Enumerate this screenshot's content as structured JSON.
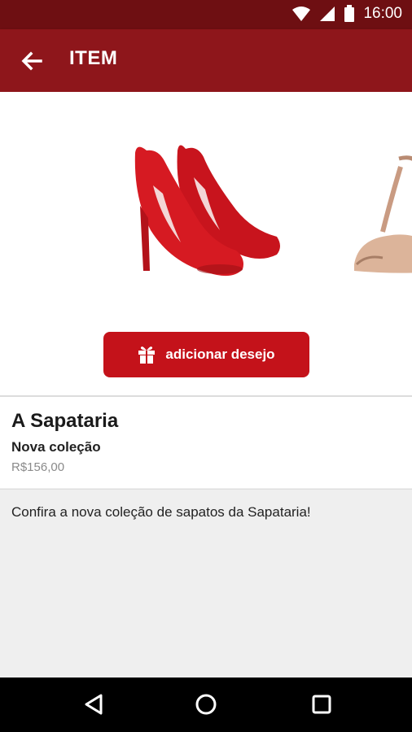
{
  "status_bar": {
    "time": "16:00",
    "icons": [
      "wifi-icon",
      "signal-icon",
      "battery-icon"
    ]
  },
  "app_bar": {
    "title": "ITEM",
    "back_icon": "arrow-left-icon"
  },
  "hero": {
    "main_image": "red-high-heel-shoes",
    "next_image": "nude-sandal-shoe",
    "wish_button": {
      "icon": "gift-icon",
      "label": "adicionar desejo"
    }
  },
  "product": {
    "store": "A Sapataria",
    "collection": "Nova coleção",
    "price": "R$156,00"
  },
  "description": "Confira a nova coleção de sapatos da Sapataria!",
  "nav": {
    "back": "nav-back-icon",
    "home": "nav-home-icon",
    "recents": "nav-recents-icon"
  },
  "colors": {
    "status": "#6e0f12",
    "app_bar": "#8e161b",
    "accent": "#c4121a"
  }
}
